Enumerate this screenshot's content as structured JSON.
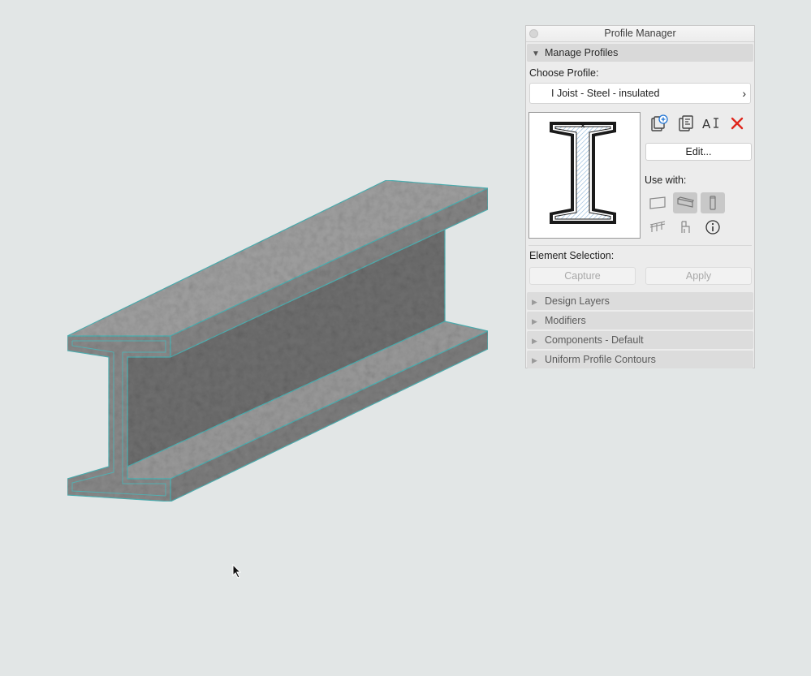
{
  "panel": {
    "title": "Profile Manager",
    "manage_section": "Manage Profiles",
    "choose_label": "Choose Profile:",
    "selected_profile": "I Joist - Steel - insulated",
    "edit_button": "Edit...",
    "use_with_label": "Use with:",
    "element_selection_label": "Element Selection:",
    "capture_button": "Capture",
    "apply_button": "Apply",
    "collapsed_sections": [
      {
        "label": "Design Layers"
      },
      {
        "label": "Modifiers"
      },
      {
        "label": "Components - Default"
      },
      {
        "label": "Uniform Profile Contours"
      }
    ]
  },
  "icons": {
    "new_profile": "new-profile-icon",
    "duplicate_profile": "duplicate-profile-icon",
    "rename_profile": "rename-profile-icon",
    "delete_profile": "delete-icon",
    "wall": "wall-tool-icon",
    "beam": "beam-tool-icon",
    "column": "column-tool-icon",
    "railing": "railing-tool-icon",
    "object": "object-tool-icon",
    "info": "info-icon"
  },
  "colors": {
    "canvas_bg": "#e2e6e6",
    "delete_red": "#e0261d",
    "selection_edge": "#4fb3b5",
    "steel": "#8c8c8c"
  }
}
